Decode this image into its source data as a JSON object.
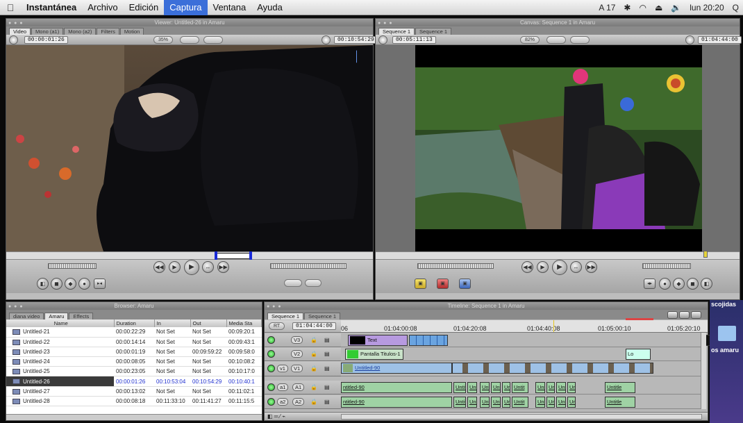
{
  "menubar": {
    "apple": "",
    "app_name": "Instantánea",
    "items": [
      "Archivo",
      "Edición",
      "Captura",
      "Ventana",
      "Ayuda"
    ],
    "active_item": "Captura",
    "status": {
      "badge": "A 17",
      "volume_icon": "speaker-icon",
      "clock": "lun 20:20",
      "search": "Q"
    }
  },
  "viewer": {
    "title": "Viewer: Untitled-26 in Amaru",
    "tabs": [
      "Video",
      "Mono (a1)",
      "Mono (a2)",
      "Filters",
      "Motion"
    ],
    "timecode_duration": "00:00:01:26",
    "zoom": "35%",
    "view_menu": "",
    "timecode_current": "00:10:54:29"
  },
  "canvas": {
    "title": "Canvas: Sequence 1 in Amaru",
    "tabs": [
      "Sequence 1",
      "Sequence 1"
    ],
    "timecode_duration": "00:05:11:13",
    "zoom": "82%",
    "timecode_current": "01:04:44:00"
  },
  "browser": {
    "title": "Browser: Amaru",
    "tabs": [
      "diana video",
      "Amaru",
      "Effects"
    ],
    "columns": [
      "Name",
      "Duration",
      "In",
      "Out",
      "Media Sta"
    ],
    "rows": [
      {
        "name": "Untitled-21",
        "duration": "00:00:22:29",
        "in": "Not Set",
        "out": "Not Set",
        "media": "00:09:20:1"
      },
      {
        "name": "Untitled-22",
        "duration": "00:00:14:14",
        "in": "Not Set",
        "out": "Not Set",
        "media": "00:09:43:1"
      },
      {
        "name": "Untitled-23",
        "duration": "00:00:01:19",
        "in": "Not Set",
        "out": "00:09:59:22",
        "media": "00:09:58:0"
      },
      {
        "name": "Untitled-24",
        "duration": "00:00:08:05",
        "in": "Not Set",
        "out": "Not Set",
        "media": "00:10:08:2"
      },
      {
        "name": "Untitled-25",
        "duration": "00:00:23:05",
        "in": "Not Set",
        "out": "Not Set",
        "media": "00:10:17:0"
      },
      {
        "name": "Untitled-26",
        "duration": "00:00:01:26",
        "in": "00:10:53:04",
        "out": "00:10:54:29",
        "media": "00:10:40:1",
        "selected": true
      },
      {
        "name": "Untitled-27",
        "duration": "00:00:13:02",
        "in": "Not Set",
        "out": "Not Set",
        "media": "00:11:02:1"
      },
      {
        "name": "Untitled-28",
        "duration": "00:00:08:18",
        "in": "00:11:33:10",
        "out": "00:11:41:27",
        "media": "00:11:15:5"
      }
    ]
  },
  "timeline": {
    "title": "Timeline: Sequence 1 in Amaru",
    "tabs": [
      "Sequence 1",
      "Sequence 1"
    ],
    "rt": "RT",
    "current_tc": "01:04:44:00",
    "ruler": [
      "06",
      "01:04:00:08",
      "01:04:20:08",
      "01:04:40:08",
      "01:05:00:10",
      "01:05:20:10"
    ],
    "tracks": [
      {
        "id": "V3",
        "clips": [
          "Text"
        ]
      },
      {
        "id": "V2",
        "clips": [
          "Pantalla Titulos-1",
          "Lo"
        ]
      },
      {
        "id": "V1",
        "src": "v1",
        "clips": [
          "Untitled-90"
        ]
      },
      {
        "id": "A1",
        "src": "a1",
        "clips": [
          "ntitled-90",
          "Untitl",
          "Unt",
          "Unt",
          "Unt",
          "Unt",
          "Untit",
          "Unt",
          "Unt",
          "Unt",
          "Unt",
          "Untitle"
        ]
      },
      {
        "id": "A2",
        "src": "a2",
        "clips": [
          "ntitled-90",
          "Untitl",
          "Unt",
          "Unt",
          "Unt",
          "Unt",
          "Untit",
          "Unt",
          "Unt",
          "Unt",
          "Unt",
          "Untitle"
        ]
      }
    ]
  },
  "desktop": {
    "label_top": "scojidas",
    "label_folder": "os amaru"
  }
}
